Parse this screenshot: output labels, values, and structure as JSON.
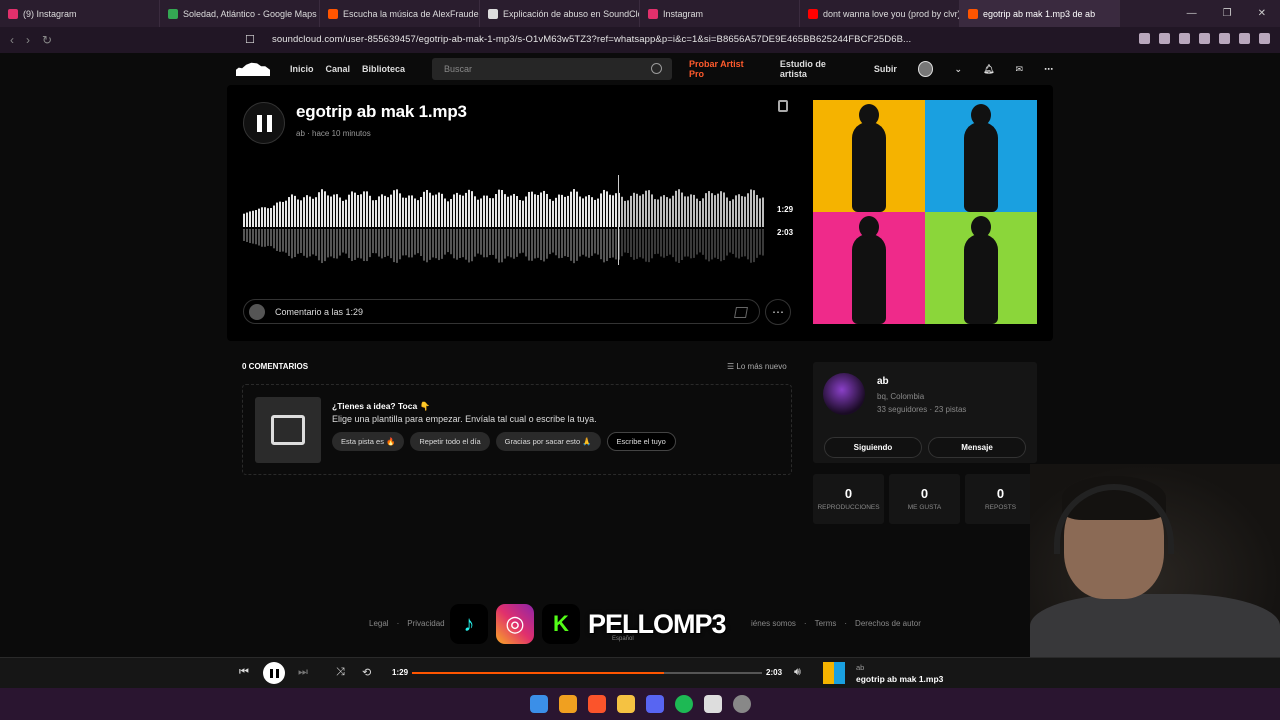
{
  "browser": {
    "tabs": [
      {
        "label": "(9) Instagram",
        "color": "#e1306c"
      },
      {
        "label": "Soledad, Atlántico - Google Maps",
        "color": "#34a853"
      },
      {
        "label": "Escucha la música de AlexFrauded |",
        "color": "#ff5500"
      },
      {
        "label": "Explicación de abuso en SoundClou",
        "color": "#dddddd"
      },
      {
        "label": "Instagram",
        "color": "#e1306c"
      },
      {
        "label": "dont wanna love you (prod by clvr)",
        "color": "#ff0000"
      },
      {
        "label": "egotrip ab mak 1.mp3 de ab",
        "color": "#ff5500"
      }
    ],
    "url": "soundcloud.com/user-855639457/egotrip-ab-mak-1-mp3/s-O1vM63w5TZ3?ref=whatsapp&p=i&c=1&si=B8656A57DE9E465BB625244FBCF25D6B..."
  },
  "header": {
    "nav": [
      "Inicio",
      "Canal",
      "Biblioteca"
    ],
    "search_placeholder": "Buscar",
    "links": [
      "Probar Artist Pro",
      "Estudio de artista",
      "Subir"
    ],
    "accent": "#ff5a2c"
  },
  "track": {
    "title": "egotrip ab mak 1.mp3",
    "artist": "ab",
    "uploaded": "hace 10 minutos",
    "current_time": "1:29",
    "duration": "2:03",
    "progress": 0.72,
    "comment_placeholder": "Comentario a las 1:29"
  },
  "comments": {
    "header": "0 COMENTARIOS",
    "sort": "Lo más nuevo",
    "prompt_title": "¿Tienes a idea? Toca 👇",
    "prompt_text": "Elige una plantilla para empezar. Envíala tal cual o escribe la tuya.",
    "chips": [
      "Esta pista es 🔥",
      "Repetir todo el día",
      "Gracias por sacar esto 🙏",
      "Escribe el tuyo"
    ]
  },
  "artist_card": {
    "name": "ab",
    "location": "bq, Colombia",
    "stats_line": "33 seguidores · 23 pistas",
    "follow_label": "Siguiendo",
    "message_label": "Mensaje"
  },
  "stats": [
    {
      "value": "0",
      "label": "REPRODUCCIONES"
    },
    {
      "value": "0",
      "label": "ME GUSTA"
    },
    {
      "value": "0",
      "label": "REPOSTS"
    }
  ],
  "footer": {
    "left": [
      "Legal",
      "Privacidad"
    ],
    "right": [
      "iénes somos",
      "Terms",
      "Derechos de autor"
    ],
    "language": "Español"
  },
  "overlay": {
    "brand": "PELLOMP3"
  },
  "player": {
    "current_time": "1:29",
    "duration": "2:03",
    "progress": 0.72,
    "artist": "ab",
    "track": "egotrip ab mak 1.mp3"
  },
  "artwork_colors": [
    "#f5b300",
    "#1aa0e0",
    "#ef2a8a",
    "#8bd63a"
  ]
}
